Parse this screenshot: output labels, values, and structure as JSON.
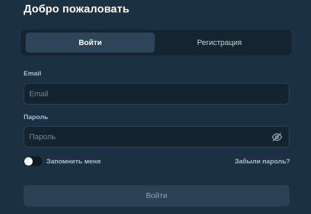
{
  "page": {
    "title": "Добро пожаловать"
  },
  "tabs": [
    {
      "label": "Войти",
      "active": true
    },
    {
      "label": "Регистрация",
      "active": false
    }
  ],
  "form": {
    "email": {
      "label": "Email",
      "placeholder": "Email",
      "value": ""
    },
    "password": {
      "label": "Пароль",
      "placeholder": "Пароль",
      "value": "",
      "toggle_icon": "eye-off-icon"
    },
    "remember": {
      "label": "Запомнить меня",
      "checked": false
    },
    "forgot_link": "Забыли пароль?",
    "submit_label": "Войти"
  },
  "colors": {
    "background": "#1b3040",
    "tab_active": "#2c4558",
    "label": "#9fc1d6",
    "submit": "#2a4253"
  }
}
